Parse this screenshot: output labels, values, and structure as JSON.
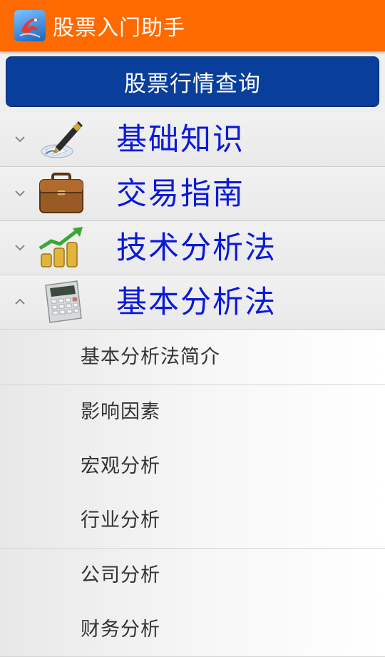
{
  "app_bar": {
    "title": "股票入门助手",
    "background_color": "#ff6a00",
    "logo_icon": "dragon-logo-icon"
  },
  "query_button": {
    "label": "股票行情查询",
    "background_color": "#0a3e9b"
  },
  "groups": [
    {
      "label": "基础知识",
      "icon": "fountain-pen-icon",
      "expanded": false
    },
    {
      "label": "交易指南",
      "icon": "briefcase-icon",
      "expanded": false
    },
    {
      "label": "技术分析法",
      "icon": "coins-chart-icon",
      "expanded": false
    },
    {
      "label": "基本分析法",
      "icon": "calculator-icon",
      "expanded": true
    }
  ],
  "subitems": [
    {
      "label": "基本分析法简介"
    },
    {
      "label": "影响因素"
    },
    {
      "label": "宏观分析"
    },
    {
      "label": "行业分析"
    },
    {
      "label": "公司分析"
    },
    {
      "label": "财务分析"
    }
  ],
  "colors": {
    "group_label": "#0b19d9",
    "subitem_label": "#333333"
  }
}
